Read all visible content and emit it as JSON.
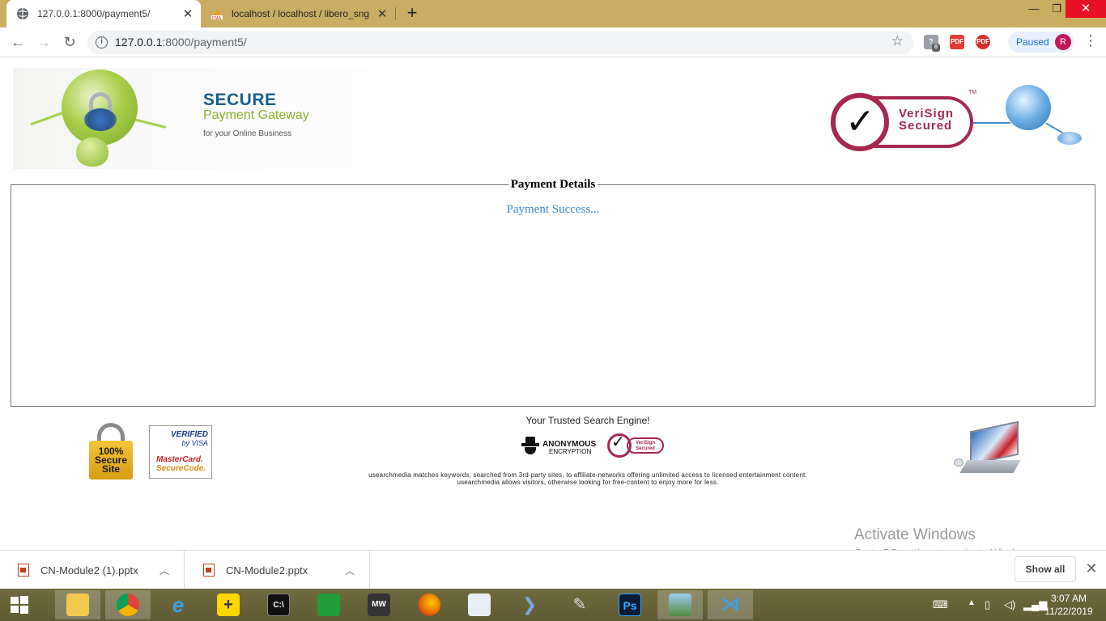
{
  "browser": {
    "tabs": [
      {
        "title": "127.0.0.1:8000/payment5/",
        "active": true
      },
      {
        "title": "localhost / localhost / libero_sng",
        "active": false
      }
    ],
    "url_host": "127.0.0.1",
    "url_path": ":8000/payment5/",
    "extensions": {
      "badge_count": "0",
      "pdf1": "PDF",
      "pdf2": "PDF"
    },
    "profile": {
      "status": "Paused",
      "initial": "R"
    }
  },
  "page": {
    "banner": {
      "title": "SECURE",
      "subtitle": "Payment Gateway",
      "tagline": "for your Online Business",
      "seal_line1": "VeriSign",
      "seal_line2": "Secured",
      "seal_tm": "TM"
    },
    "payment": {
      "legend": "Payment Details",
      "message": "Payment Success..."
    },
    "footer": {
      "lock_badge": [
        "100%",
        "Secure",
        "Site"
      ],
      "visa_line1": "VERIFIED",
      "visa_line2": "by VISA",
      "mc_line1": "MasterCard.",
      "mc_line2": "SecureCode.",
      "trusted": "Your Trusted Search Engine!",
      "anon_line1": "ANONYMOUS",
      "anon_line2": "ENCRYPTION",
      "small_seal_line1": "VeriSign",
      "small_seal_line2": "Secured",
      "disclaimer_line1": "usearchmedia matches keywords, searched from 3rd-party sites, to affiliate-networks offering unlimited access to licensed entertainment content.",
      "disclaimer_line2": "usearchmedia allows visitors, otherwise looking for free-content to enjoy more for less."
    },
    "watermark": {
      "line1": "Activate Windows",
      "line2": "Go to PC settings to activate Windows."
    }
  },
  "downloads": {
    "items": [
      {
        "name": "CN-Module2 (1).pptx"
      },
      {
        "name": "CN-Module2.pptx"
      }
    ],
    "show_all": "Show all"
  },
  "taskbar": {
    "apps": [
      "File Explorer",
      "Chrome",
      "Internet Explorer",
      "App",
      "Command Prompt",
      "Store",
      "MFG MW",
      "Firefox",
      "Reader",
      "Dolphin",
      "Tools",
      "Photoshop",
      "Photos",
      "Visual Studio Code"
    ],
    "ps_label": "Ps",
    "mw_label": "MW",
    "time": "3:07 AM",
    "date": "11/22/2019"
  },
  "colors": {
    "titlebar": "#c9ad62",
    "success_text": "#3a86cf",
    "verisign": "#a6284e",
    "secure_title": "#1a5e8c",
    "gateway_green": "#8ab02a"
  }
}
